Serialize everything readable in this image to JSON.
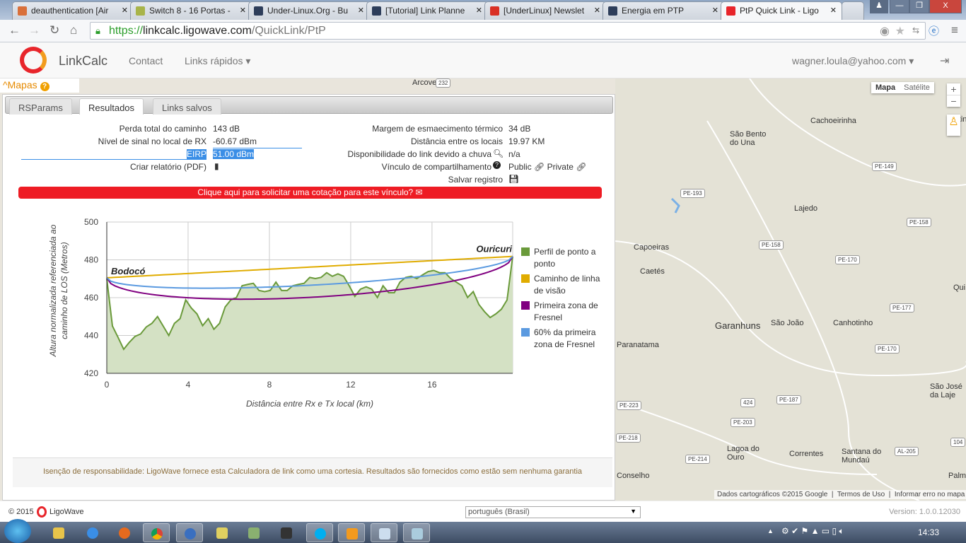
{
  "browser": {
    "tabs": [
      {
        "title": "deauthentication [Air",
        "color": "#d9703a"
      },
      {
        "title": "Switch 8 - 16 Portas -",
        "color": "#a8b44a"
      },
      {
        "title": "Under-Linux.Org - Bu",
        "color": "#2d3d5a"
      },
      {
        "title": "[Tutorial] Link Planne",
        "color": "#2d3d5a"
      },
      {
        "title": "[UnderLinux] Newslet",
        "color": "#d93025"
      },
      {
        "title": "Energia em PTP",
        "color": "#2d3d5a"
      },
      {
        "title": "PtP Quick Link - Ligo",
        "color": "#e8252b"
      }
    ],
    "url_scheme": "https://",
    "url_host": "linkcalc.ligowave.com",
    "url_path": "/QuickLink/PtP"
  },
  "app": {
    "brand": "LinkCalc",
    "nav": [
      "Contact",
      "Links rápidos ▾"
    ],
    "user": "wagner.loula@yahoo.com ▾"
  },
  "mapas_toggle": "Mapas",
  "panel": {
    "tabs": [
      "RSParams",
      "Resultados",
      "Links salvos"
    ],
    "left": [
      {
        "label": "Perda total do caminho",
        "value": "143 dB"
      },
      {
        "label": "Nível de sinal no local de RX",
        "value": "-60.67 dBm"
      },
      {
        "label": "EIRP",
        "value": "51.00 dBm"
      },
      {
        "label": "Criar relatório (PDF)",
        "value": ""
      }
    ],
    "right": [
      {
        "label": "Margem de esmaecimento térmico",
        "value": "34 dB"
      },
      {
        "label": "Distância entre os locais",
        "value": "19.97 KM"
      },
      {
        "label": "Disponibilidade do link devido a chuva",
        "value": "n/a"
      },
      {
        "label": "Vínculo de compartilhamento",
        "value_public": "Public",
        "value_private": "Private"
      },
      {
        "label": "Salvar registro",
        "value": ""
      }
    ],
    "quote_button": "Clique aqui para solicitar uma cotação para este vínculo? ✉",
    "disclaimer": "Isenção de responsabilidade: LigoWave fornece esta Calculadora de link como uma cortesia. Resultados são fornecidos como estão sem nenhuma garantia"
  },
  "chart_data": {
    "type": "area",
    "title": "Perfil de caminho entre os sites de TX e RX",
    "xlabel": "Distância entre Rx e Tx local (km)",
    "ylabel": "Altura normalizada referenciada ao caminho de LOS (Metros)",
    "xlim": [
      0,
      19.97
    ],
    "ylim": [
      420,
      500
    ],
    "xticks": [
      0,
      4,
      8,
      12,
      16
    ],
    "yticks": [
      420,
      440,
      460,
      480,
      500
    ],
    "grid": true,
    "site_tx": "Bodocó",
    "site_rx": "Ouricuri",
    "los_start": 470.5,
    "los_end": 481.8,
    "fresnel_radius_mid_m": 16,
    "profile": [
      470,
      445,
      439,
      432.7,
      436.4,
      439.5,
      440.8,
      444.5,
      446.4,
      450,
      445,
      440,
      446.4,
      448.9,
      458.8,
      454.5,
      451.4,
      445.2,
      448.9,
      443.3,
      446.4,
      455.1,
      458.8,
      460.1,
      466.3,
      467,
      467.6,
      463.8,
      463.2,
      463.8,
      468.2,
      463.8,
      463.8,
      466.3,
      467,
      467.6,
      470.7,
      470.1,
      470.7,
      473.2,
      471.3,
      472.6,
      471.3,
      466.3,
      460.7,
      464.5,
      465.7,
      464.5,
      460.1,
      466.3,
      462.6,
      462.6,
      468.2,
      470.7,
      471.3,
      470.1,
      472,
      473.8,
      474.4,
      473.2,
      473.2,
      470.1,
      468.2,
      466.3,
      460.1,
      463.2,
      456.4,
      452.6,
      449.5,
      451.4,
      453.9,
      458.8,
      481.8
    ],
    "legend": [
      {
        "name": "Perfil de ponto a ponto",
        "color": "#6a9a3a"
      },
      {
        "name": "Caminho de linha de visão",
        "color": "#e0ac00"
      },
      {
        "name": "Primeira zona de Fresnel",
        "color": "#800080"
      },
      {
        "name": "60% da primeira zona de Fresnel",
        "color": "#5b9ae0"
      }
    ],
    "legend_position": "right"
  },
  "map": {
    "type_buttons": [
      "Mapa",
      "Satélite"
    ],
    "labels": [
      "Arcoverde",
      "Cachoeirinha",
      "São Bento do Una",
      "Lajedo",
      "Capoeiras",
      "Caetés",
      "Garanhuns",
      "São João",
      "Canhotinho",
      "Paranatama",
      "São José da Laje",
      "Lagoa do Ouro",
      "Correntes",
      "Santana do Mundaú",
      "Conselho",
      "Palm",
      "Altin",
      "Qui"
    ],
    "shields": [
      "232",
      "PE-149",
      "PE-193",
      "PE-158",
      "PE-158",
      "PE-170",
      "PE-177",
      "PE-170",
      "PE-187",
      "424",
      "PE-203",
      "PE-218",
      "PE-214",
      "AL-205",
      "104",
      "PE-223"
    ],
    "attribution": [
      "Dados cartográficos ©2015 Google",
      "Termos de Uso",
      "Informar erro no mapa"
    ]
  },
  "footer": {
    "copyright": "© 2015",
    "company": "LigoWave",
    "language": "português (Brasil)",
    "version": "Version: 1.0.0.12030"
  },
  "taskbar": {
    "clock": "14:33"
  }
}
